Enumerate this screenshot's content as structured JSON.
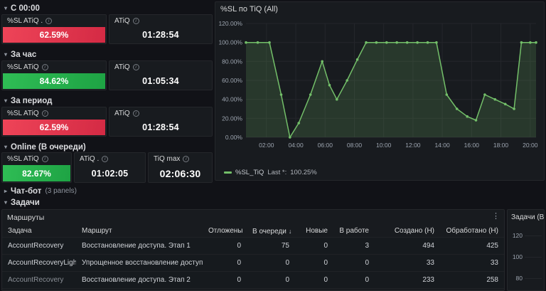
{
  "icons": {
    "chevron_down": "▾",
    "chevron_right": "▸",
    "info": "i",
    "menu": "⋮",
    "sort_down": "↓"
  },
  "colors": {
    "page_bg": "#111217",
    "panel_bg": "#181b1f",
    "red": "#e02f44",
    "green": "#24ad4c",
    "series_green": "#73bf69"
  },
  "sections": [
    {
      "title": "С 00:00",
      "panels": [
        {
          "title": "%SL ATiQ .",
          "value": "62.59%",
          "status_color": "#e02f44"
        },
        {
          "title": "ATiQ",
          "value": "01:28:54"
        }
      ]
    },
    {
      "title": "За час",
      "panels": [
        {
          "title": "%SL ATiQ",
          "value": "84.62%",
          "status_color": "#24ad4c"
        },
        {
          "title": "ATiQ",
          "value": "01:05:34"
        }
      ]
    },
    {
      "title": "За период",
      "panels": [
        {
          "title": "%SL ATiQ",
          "value": "62.59%",
          "status_color": "#e02f44"
        },
        {
          "title": "ATiQ",
          "value": "01:28:54"
        }
      ]
    },
    {
      "title": "Online (В очереди)",
      "panels": [
        {
          "title": "%SL ATiQ",
          "value": "82.67%",
          "status_color": "#24ad4c"
        },
        {
          "title": "ATiQ .",
          "value": "01:02:05"
        },
        {
          "title": "TiQ max",
          "value": "02:06:30"
        }
      ]
    }
  ],
  "chatbot_row": {
    "title": "Чат-бот",
    "count": "(3 panels)"
  },
  "tasks_row": {
    "title": "Задачи"
  },
  "chart_data": [
    {
      "type": "area",
      "title": "%SL по TiQ (All)",
      "xlabel": "",
      "ylabel": "",
      "ylim": [
        0,
        120
      ],
      "grid": true,
      "legend_position": "bottom",
      "x_range_hours": [
        0.6,
        20.4
      ],
      "x_ticks": [
        "02:00",
        "04:00",
        "06:00",
        "08:00",
        "10:00",
        "12:00",
        "14:00",
        "16:00",
        "18:00",
        "20:00"
      ],
      "x_tick_hours": [
        2,
        4,
        6,
        8,
        10,
        12,
        14,
        16,
        18,
        20
      ],
      "y_ticks": [
        "0.00%",
        "20.00%",
        "40.00%",
        "60.00%",
        "80.00%",
        "100.00%",
        "120.00%"
      ],
      "y_tick_values": [
        0,
        20,
        40,
        60,
        80,
        100,
        120
      ],
      "series": [
        {
          "name": "%SL_TiQ",
          "color": "#73bf69",
          "x_hours": [
            0.6,
            1.4,
            2.2,
            3.0,
            3.6,
            4.2,
            5.0,
            5.8,
            6.3,
            6.8,
            7.5,
            8.2,
            8.8,
            9.5,
            10.2,
            10.9,
            11.6,
            12.3,
            13.0,
            13.6,
            14.3,
            15.0,
            15.7,
            16.3,
            16.9,
            17.6,
            18.3,
            18.9,
            19.4,
            20.0,
            20.4
          ],
          "values": [
            100,
            100,
            100,
            45,
            0,
            15,
            45,
            80,
            55,
            40,
            60,
            82,
            100,
            100,
            100,
            100,
            100,
            100,
            100,
            100,
            45,
            30,
            22,
            18,
            45,
            40,
            35,
            30,
            100,
            100,
            100
          ]
        }
      ],
      "legend": {
        "label": "%SL_TiQ",
        "last_title": "Last *:",
        "last_value": "100.25%"
      }
    },
    {
      "type": "bar",
      "title": "Задачи (В",
      "y_ticks": [
        "120",
        "100",
        "80"
      ],
      "truncated": true
    }
  ],
  "table": {
    "panel_title": "Маршруты",
    "columns": [
      "Задача",
      "Маршрут",
      "Отложены",
      "В очереди",
      "Новые",
      "В работе",
      "Создано (Н)",
      "Обработано (Н)"
    ],
    "sort": {
      "column": "В очереди",
      "direction": "desc"
    },
    "rows": [
      [
        "AccountRecovery",
        "Восстановление доступа. Этап 1",
        "0",
        "75",
        "0",
        "3",
        "494",
        "425"
      ],
      [
        "AccountRecoveryLight",
        "Упрощенное восстановление доступа",
        "0",
        "0",
        "0",
        "0",
        "33",
        "33"
      ],
      [
        "AccountRecovery",
        "Восстановление доступа. Этап 2",
        "0",
        "0",
        "0",
        "0",
        "233",
        "258"
      ]
    ]
  }
}
